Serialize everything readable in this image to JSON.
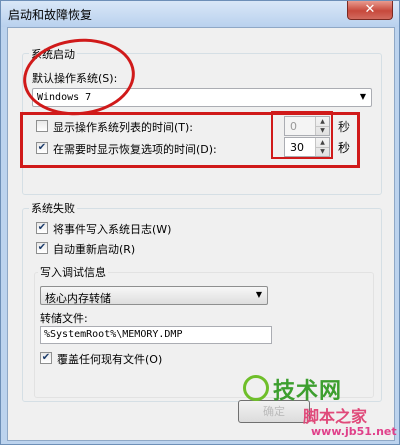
{
  "window": {
    "title": "启动和故障恢复",
    "close_glyph": "✕"
  },
  "system_startup": {
    "group_title": "系统启动",
    "default_os_label": "默认操作系统(S):",
    "default_os_value": "Windows 7",
    "show_os_list_label": "显示操作系统列表的时间(T):",
    "show_os_list_checked": false,
    "show_os_list_value": "0",
    "show_recovery_label": "在需要时显示恢复选项的时间(D):",
    "show_recovery_checked": true,
    "show_recovery_value": "30",
    "seconds_unit": "秒"
  },
  "system_failure": {
    "group_title": "系统失败",
    "write_event_label": "将事件写入系统日志(W)",
    "write_event_checked": true,
    "auto_restart_label": "自动重新启动(R)",
    "auto_restart_checked": true,
    "debug_info": {
      "group_title": "写入调试信息",
      "dump_type_value": "核心内存转储",
      "dump_file_label": "转储文件:",
      "dump_file_value": "%SystemRoot%\\MEMORY.DMP",
      "overwrite_label": "覆盖任何现有文件(O)",
      "overwrite_checked": true
    }
  },
  "buttons": {
    "ok_label": "确定"
  },
  "watermark": {
    "logo_text": "技术网",
    "sub_text": "脚本之家",
    "url": "www.jb51.net"
  }
}
